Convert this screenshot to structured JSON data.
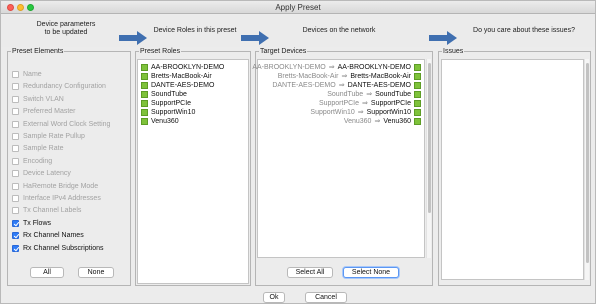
{
  "window": {
    "title": "Apply Preset"
  },
  "steps": [
    {
      "label_line1": "Device parameters",
      "label_line2": "to be updated"
    },
    {
      "label": "Device Roles in this preset"
    },
    {
      "label": "Devices on the network"
    },
    {
      "label": "Do you care about these issues?"
    }
  ],
  "colors": {
    "step_arrow": "#3f6fb0",
    "status_ok": "#7ec23a",
    "checkbox_on": "#2f7bf5"
  },
  "preset_elements": {
    "title": "Preset Elements",
    "items": [
      {
        "label": "Name",
        "checked": false,
        "enabled": false
      },
      {
        "label": "Redundancy Configuration",
        "checked": false,
        "enabled": false
      },
      {
        "label": "Switch VLAN",
        "checked": false,
        "enabled": false
      },
      {
        "label": "Preferred Master",
        "checked": false,
        "enabled": false
      },
      {
        "label": "External Word Clock Setting",
        "checked": false,
        "enabled": false
      },
      {
        "label": "Sample Rate Pullup",
        "checked": false,
        "enabled": false
      },
      {
        "label": "Sample Rate",
        "checked": false,
        "enabled": false
      },
      {
        "label": "Encoding",
        "checked": false,
        "enabled": false
      },
      {
        "label": "Device Latency",
        "checked": false,
        "enabled": false
      },
      {
        "label": "HaRemote Bridge Mode",
        "checked": false,
        "enabled": false
      },
      {
        "label": "Interface IPv4 Addresses",
        "checked": false,
        "enabled": false
      },
      {
        "label": "Tx Channel Labels",
        "checked": false,
        "enabled": false
      },
      {
        "label": "Tx Flows",
        "checked": true,
        "enabled": true
      },
      {
        "label": "Rx Channel Names",
        "checked": true,
        "enabled": true
      },
      {
        "label": "Rx Channel Subscriptions",
        "checked": true,
        "enabled": true
      }
    ],
    "all_button": "All",
    "none_button": "None"
  },
  "preset_roles": {
    "title": "Preset Roles",
    "items": [
      "AA-BROOKLYN-DEMO",
      "Bretts-MacBook-Air",
      "DANTE-AES-DEMO",
      "SoundTube",
      "SupportPCIe",
      "SupportWin10",
      "Venu360"
    ]
  },
  "target_devices": {
    "title": "Target Devices",
    "rows": [
      {
        "source": "AA-BROOKLYN-DEMO",
        "arrow": "⇒",
        "target": "AA-BROOKLYN-DEMO"
      },
      {
        "source": "Bretts-MacBook-Air",
        "arrow": "⇒",
        "target": "Bretts-MacBook-Air"
      },
      {
        "source": "DANTE-AES-DEMO",
        "arrow": "⇒",
        "target": "DANTE-AES-DEMO"
      },
      {
        "source": "SoundTube",
        "arrow": "⇒",
        "target": "SoundTube"
      },
      {
        "source": "SupportPCIe",
        "arrow": "⇒",
        "target": "SupportPCIe"
      },
      {
        "source": "SupportWin10",
        "arrow": "⇒",
        "target": "SupportWin10"
      },
      {
        "source": "Venu360",
        "arrow": "⇒",
        "target": "Venu360"
      }
    ],
    "select_all_button": "Select All",
    "select_none_button": "Select None"
  },
  "issues": {
    "title": "Issues"
  },
  "footer": {
    "ok_button": "Ok",
    "cancel_button": "Cancel"
  }
}
